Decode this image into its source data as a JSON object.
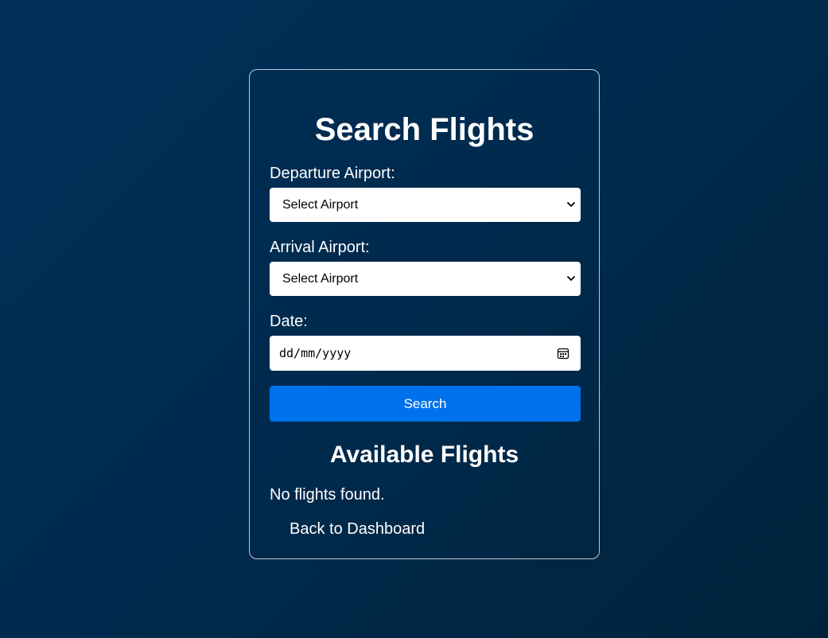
{
  "page": {
    "title": "Search Flights"
  },
  "form": {
    "departure_label": "Departure Airport:",
    "departure_value": "Select Airport",
    "arrival_label": "Arrival Airport:",
    "arrival_value": "Select Airport",
    "date_label": "Date:",
    "date_placeholder": "dd/mm/yyyy",
    "search_label": "Search"
  },
  "results": {
    "title": "Available Flights",
    "empty_message": "No flights found."
  },
  "nav": {
    "back_label": "Back to Dashboard"
  },
  "colors": {
    "background": "#00305a",
    "button": "#0071ed"
  },
  "icons": {
    "select_chevron": "chevron-down-icon",
    "date_picker": "calendar-icon"
  }
}
